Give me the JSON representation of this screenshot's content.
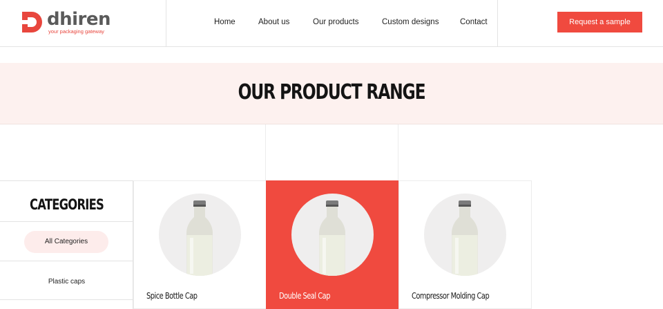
{
  "header": {
    "logo": {
      "name": "dhiren",
      "tagline": "your packaging gateway"
    },
    "nav": [
      {
        "label": "Home"
      },
      {
        "label": "About us"
      },
      {
        "label": "Our products"
      },
      {
        "label": "Custom designs"
      },
      {
        "label": "Contact"
      }
    ],
    "cta_label": "Request a sample"
  },
  "hero": {
    "title": "OUR PRODUCT RANGE"
  },
  "categories": {
    "title": "CATEGORIES",
    "items": [
      {
        "label": "All Categories",
        "selected": true
      },
      {
        "label": "Plastic caps",
        "selected": false
      }
    ]
  },
  "products": [
    {
      "name": "Spice Bottle Cap",
      "image": "milk-bottle-icon",
      "highlighted": false
    },
    {
      "name": "Double Seal Cap",
      "image": "milk-bottle-icon",
      "highlighted": true
    },
    {
      "name": "Compressor Molding Cap",
      "image": "milk-bottle-icon",
      "highlighted": false
    }
  ],
  "colors": {
    "accent": "#f04a3f",
    "hero_bg": "#fdf1ef",
    "pill_bg": "#fdeceb",
    "brand_text": "#5a5a5a"
  }
}
